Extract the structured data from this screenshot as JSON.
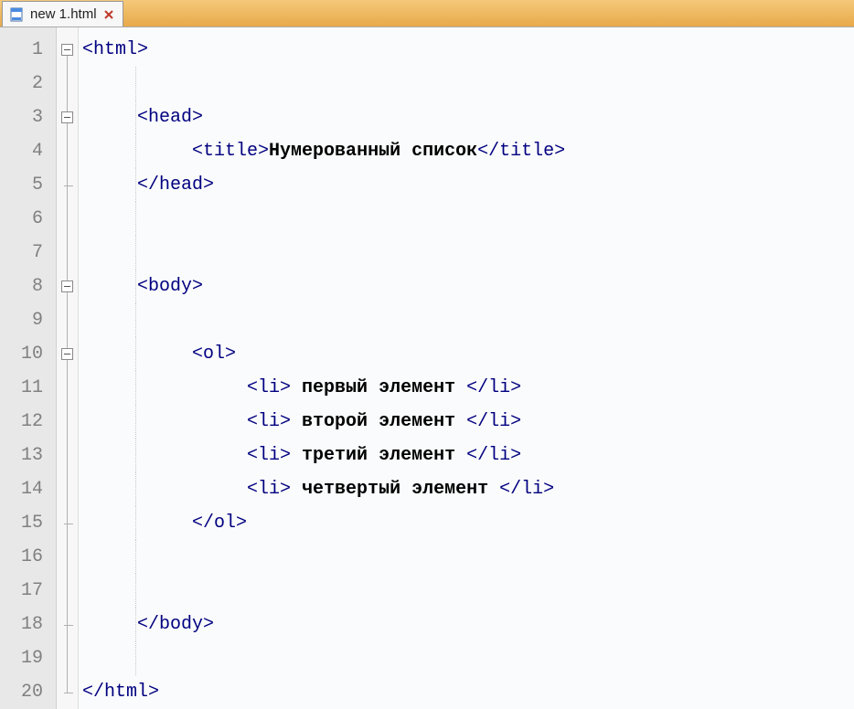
{
  "tab": {
    "title": "new  1.html"
  },
  "code": {
    "line1": {
      "open": "<html>"
    },
    "line2": {
      "blank": ""
    },
    "line3": {
      "open": "<head>"
    },
    "line4": {
      "o": "<title>",
      "t": "Нумерованный список",
      "c": "</title>"
    },
    "line5": {
      "close": "</head>"
    },
    "line6": {
      "blank": ""
    },
    "line7": {
      "blank": ""
    },
    "line8": {
      "open": "<body>"
    },
    "line9": {
      "blank": ""
    },
    "line10": {
      "open": "<ol>"
    },
    "line11": {
      "o": "<li>",
      "t": " первый элемент ",
      "c": "</li>"
    },
    "line12": {
      "o": "<li>",
      "t": " второй элемент ",
      "c": "</li>"
    },
    "line13": {
      "o": "<li>",
      "t": " третий элемент ",
      "c": "</li>"
    },
    "line14": {
      "o": "<li>",
      "t": " четвертый элемент ",
      "c": "</li>"
    },
    "line15": {
      "close": "</ol>"
    },
    "line16": {
      "blank": ""
    },
    "line17": {
      "blank": ""
    },
    "line18": {
      "close": "</body>"
    },
    "line19": {
      "blank": ""
    },
    "line20": {
      "close": "</html>"
    }
  },
  "ln": {
    "l1": "1",
    "l2": "2",
    "l3": "3",
    "l4": "4",
    "l5": "5",
    "l6": "6",
    "l7": "7",
    "l8": "8",
    "l9": "9",
    "l10": "10",
    "l11": "11",
    "l12": "12",
    "l13": "13",
    "l14": "14",
    "l15": "15",
    "l16": "16",
    "l17": "17",
    "l18": "18",
    "l19": "19",
    "l20": "20"
  }
}
